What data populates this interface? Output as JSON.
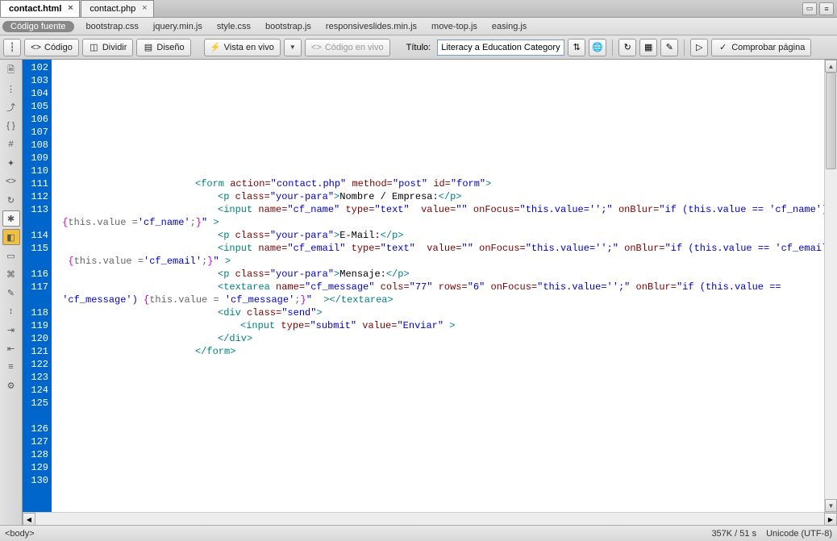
{
  "tabs": [
    {
      "label": "contact.html",
      "active": true
    },
    {
      "label": "contact.php",
      "active": false
    }
  ],
  "source_pill": "Código fuente",
  "sub_tabs": [
    "bootstrap.css",
    "jquery.min.js",
    "style.css",
    "bootstrap.js",
    "responsiveslides.min.js",
    "move-top.js",
    "easing.js"
  ],
  "toolbar": {
    "code": "Código",
    "split": "Dividir",
    "design": "Diseño",
    "live_view": "Vista en vivo",
    "live_code": "Código en vivo",
    "title_label": "Título:",
    "title_value": "Literacy a Education Category",
    "check_page": "Comprobar página"
  },
  "line_numbers_start": 102,
  "line_numbers_end": 130,
  "code_lines": [
    {
      "n": 102,
      "html": ""
    },
    {
      "n": 103,
      "html": ""
    },
    {
      "n": 104,
      "html": ""
    },
    {
      "n": 105,
      "html": ""
    },
    {
      "n": 106,
      "html": ""
    },
    {
      "n": 107,
      "html": ""
    },
    {
      "n": 108,
      "html": ""
    },
    {
      "n": 109,
      "html": ""
    },
    {
      "n": 110,
      "html": ""
    },
    {
      "n": 111,
      "indent": 1,
      "html": "<span class='c-tag'>&lt;form</span> <span class='c-attr'>action=</span><span class='c-val'>\"contact.php\"</span> <span class='c-attr'>method=</span><span class='c-val'>\"post\"</span> <span class='c-attr'>id=</span><span class='c-val'>\"form\"</span><span class='c-tag'>&gt;</span>"
    },
    {
      "n": 112,
      "indent": 2,
      "html": "<span class='c-tag'>&lt;p</span> <span class='c-attr'>class=</span><span class='c-val'>\"your-para\"</span><span class='c-tag'>&gt;</span><span class='c-txt'>Nombre / Empresa:</span><span class='c-tag'>&lt;/p&gt;</span>"
    },
    {
      "n": 113,
      "indent": 2,
      "html": "<span class='c-tag'>&lt;input</span> <span class='c-attr'>name=</span><span class='c-val'>\"cf_name\"</span> <span class='c-attr'>type=</span><span class='c-val'>\"text\"</span>  <span class='c-attr'>value=</span><span class='c-val'>\"\"</span> <span class='c-attr'>onFocus=</span><span class='c-val'>\"this.value='';\"</span> <span class='c-attr'>onBlur=</span><span class='c-val'>\"if (this.value == 'cf_name')</span>"
    },
    {
      "n": -1,
      "wrap": true,
      "html": " <span class='c-brace'>{</span><span class='c-js'>this.value =</span><span class='c-val'>'cf_name'</span><span class='c-js'>;</span><span class='c-brace'>}</span><span class='c-val'>\"</span> <span class='c-tag'>&gt;</span>"
    },
    {
      "n": 114,
      "indent": 2,
      "html": "<span class='c-tag'>&lt;p</span> <span class='c-attr'>class=</span><span class='c-val'>\"your-para\"</span><span class='c-tag'>&gt;</span><span class='c-txt'>E-Mail:</span><span class='c-tag'>&lt;/p&gt;</span>"
    },
    {
      "n": 115,
      "indent": 2,
      "html": "<span class='c-tag'>&lt;input</span> <span class='c-attr'>name=</span><span class='c-val'>\"cf_email\"</span> <span class='c-attr'>type=</span><span class='c-val'>\"text\"</span>  <span class='c-attr'>value=</span><span class='c-val'>\"\"</span> <span class='c-attr'>onFocus=</span><span class='c-val'>\"this.value='';\"</span> <span class='c-attr'>onBlur=</span><span class='c-val'>\"if (this.value == 'cf_email')</span>"
    },
    {
      "n": -1,
      "wrap": true,
      "html": "  <span class='c-brace'>{</span><span class='c-js'>this.value =</span><span class='c-val'>'cf_email'</span><span class='c-js'>;</span><span class='c-brace'>}</span><span class='c-val'>\"</span> <span class='c-tag'>&gt;</span>"
    },
    {
      "n": 116,
      "indent": 2,
      "html": "<span class='c-tag'>&lt;p</span> <span class='c-attr'>class=</span><span class='c-val'>\"your-para\"</span><span class='c-tag'>&gt;</span><span class='c-txt'>Mensaje:</span><span class='c-tag'>&lt;/p&gt;</span>"
    },
    {
      "n": 117,
      "indent": 2,
      "html": "<span class='c-tag'>&lt;textarea</span> <span class='c-attr'>name=</span><span class='c-val'>\"cf_message\"</span> <span class='c-attr'>cols=</span><span class='c-val'>\"77\"</span> <span class='c-attr'>rows=</span><span class='c-val'>\"6\"</span> <span class='c-attr'>onFocus=</span><span class='c-val'>\"this.value='';\"</span> <span class='c-attr'>onBlur=</span><span class='c-val'>\"if (this.value ==</span>"
    },
    {
      "n": -1,
      "wrap": true,
      "html": " <span class='c-val'>'cf_message')</span> <span class='c-brace'>{</span><span class='c-js'>this.value = </span><span class='c-val'>'cf_message'</span><span class='c-js'>;</span><span class='c-brace'>}</span><span class='c-val'>\"</span>  <span class='c-tag'>&gt;&lt;/textarea&gt;</span>"
    },
    {
      "n": 118,
      "indent": 2,
      "html": "<span class='c-tag'>&lt;div</span> <span class='c-attr'>class=</span><span class='c-val'>\"send\"</span><span class='c-tag'>&gt;</span>"
    },
    {
      "n": 119,
      "indent": 3,
      "html": "<span class='c-tag'>&lt;input</span> <span class='c-attr'>type=</span><span class='c-val'>\"submit\"</span> <span class='c-attr'>value=</span><span class='c-val'>\"Enviar\"</span> <span class='c-tag'>&gt;</span>"
    },
    {
      "n": 120,
      "indent": 2,
      "html": "<span class='c-tag'>&lt;/div&gt;</span>"
    },
    {
      "n": 121,
      "indent": 1,
      "html": "<span class='c-tag'>&lt;/form&gt;</span>"
    },
    {
      "n": 122,
      "html": ""
    },
    {
      "n": 123,
      "html": ""
    },
    {
      "n": 124,
      "html": ""
    },
    {
      "n": 125,
      "html": ""
    },
    {
      "n": -2,
      "gap": true
    },
    {
      "n": 126,
      "html": ""
    },
    {
      "n": 127,
      "html": ""
    },
    {
      "n": 128,
      "html": ""
    },
    {
      "n": 129,
      "html": ""
    },
    {
      "n": 130,
      "html": ""
    }
  ],
  "status": {
    "left": "<body>",
    "size": "357K / 51 s",
    "encoding": "Unicode (UTF-8)"
  }
}
